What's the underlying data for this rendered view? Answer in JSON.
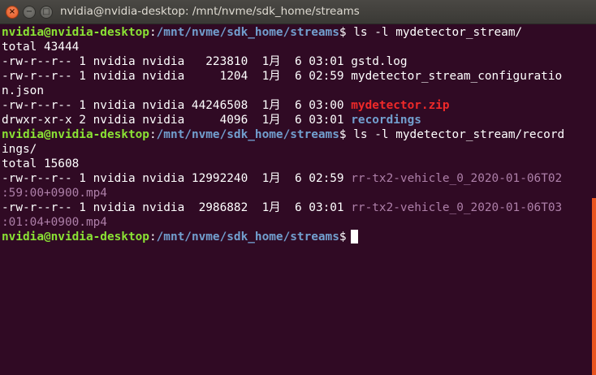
{
  "window": {
    "title": "nvidia@nvidia-desktop: /mnt/nvme/sdk_home/streams",
    "close_icon": "×",
    "minimize_icon": "−",
    "maximize_icon": "□"
  },
  "prompt": {
    "user": "nvidia@nvidia-desktop",
    "sep": ":",
    "path": "/mnt/nvme/sdk_home/streams",
    "symbol": "$"
  },
  "lines": {
    "cmd1": " ls -l mydetector_stream/",
    "total1": "total 43444",
    "l1": "-rw-r--r-- 1 nvidia nvidia   223810  1月  6 03:01 gstd.log",
    "l2a": "-rw-r--r-- 1 nvidia nvidia     1204  1月  6 02:59 mydetector_stream_configuratio",
    "l2b": "n.json",
    "l3pre": "-rw-r--r-- 1 nvidia nvidia 44246508  1月  6 03:00 ",
    "l3name": "mydetector.zip",
    "l4pre": "drwxr-xr-x 2 nvidia nvidia     4096  1月  6 03:01 ",
    "l4name": "recordings",
    "cmd2a": " ls -l mydetector_stream/record",
    "cmd2b": "ings/",
    "total2": "total 15608",
    "l5pre": "-rw-r--r-- 1 nvidia nvidia 12992240  1月  6 02:59 ",
    "l5name": "rr-tx2-vehicle_0_2020-01-06T02",
    "l5cont": ":59:00+0900.mp4",
    "l6pre": "-rw-r--r-- 1 nvidia nvidia  2986882  1月  6 03:01 ",
    "l6name": "rr-tx2-vehicle_0_2020-01-06T03",
    "l6cont": ":01:04+0900.mp4"
  },
  "colors": {
    "background": "#300a24",
    "prompt_user": "#8ae234",
    "prompt_path": "#729fcf",
    "archive": "#ef2929",
    "directory": "#729fcf",
    "media": "#ad7fa8"
  }
}
